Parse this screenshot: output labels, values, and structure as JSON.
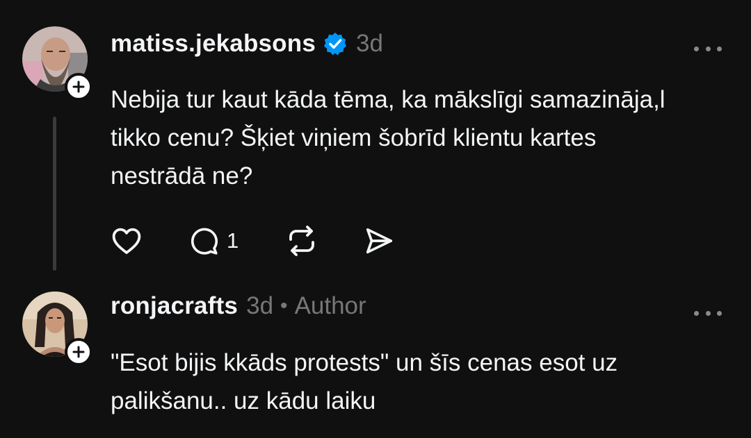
{
  "comments": [
    {
      "username": "matiss.jekabsons",
      "verified": true,
      "time": "3d",
      "text_lines": [
        "Nebija tur kaut kāda tēma, ka mākslīgi samazināja,l",
        "tikko cenu? Šķiet viņiem šobrīd klientu kartes",
        "nestrādā ne?"
      ],
      "reply_count": "1",
      "icons": {
        "like": "heart-icon",
        "reply": "comment-bubble-icon",
        "repost": "repost-icon",
        "share": "send-icon"
      }
    },
    {
      "username": "ronjacrafts",
      "time": "3d",
      "separator": "•",
      "author_badge": "Author",
      "text_lines": [
        "\"Esot bijis kkāds protests\" un šīs cenas esot uz",
        "palikšanu.. uz kādu laiku"
      ]
    }
  ],
  "colors": {
    "background": "#101010",
    "text_primary": "#f3f5f7",
    "text_secondary": "#777777",
    "verified_blue": "#0095f6"
  }
}
